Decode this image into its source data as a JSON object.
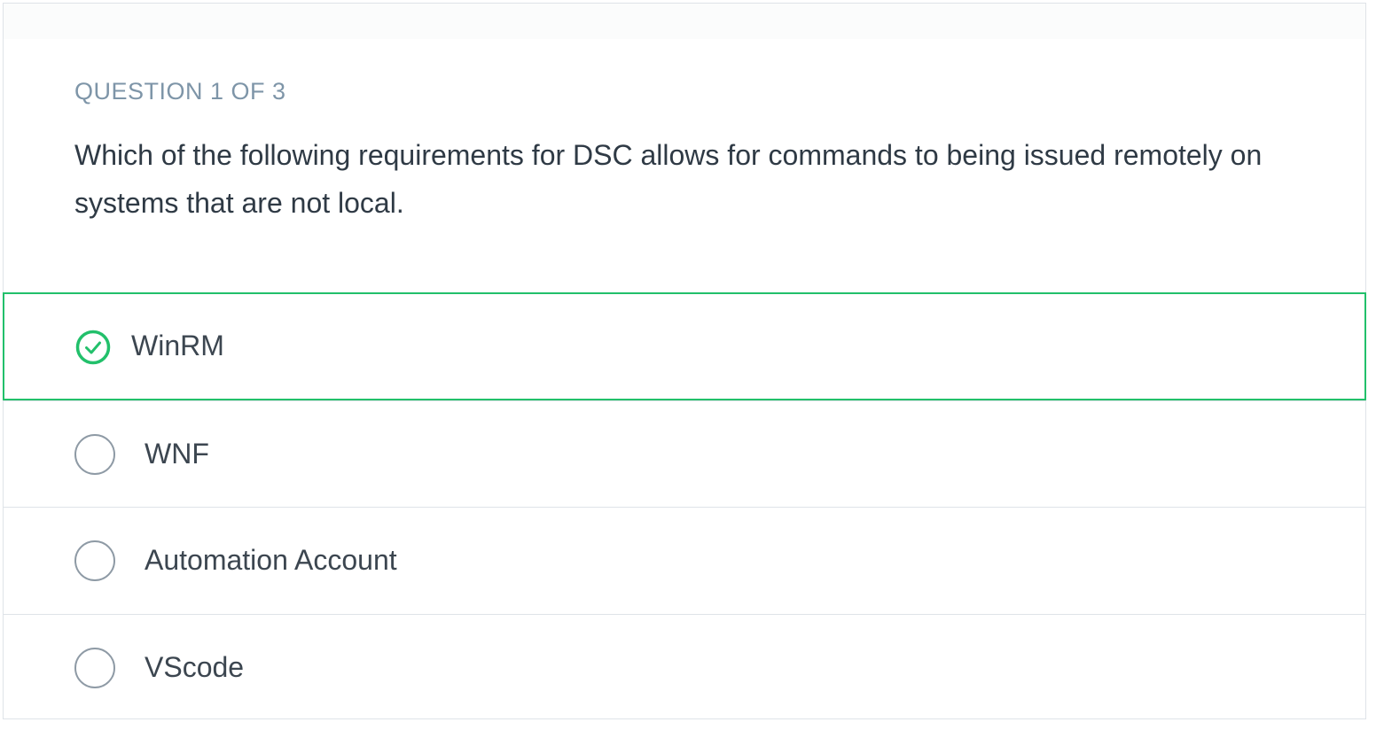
{
  "question": {
    "counter": "QUESTION 1 OF 3",
    "text": "Which of the following requirements for DSC allows for commands to being issued remotely on systems that are not local."
  },
  "options": [
    {
      "label": "WinRM",
      "state": "correct",
      "icon": "check-circle-icon"
    },
    {
      "label": "WNF",
      "state": "unselected",
      "icon": "radio-circle-icon"
    },
    {
      "label": "Automation Account",
      "state": "unselected",
      "icon": "radio-circle-icon"
    },
    {
      "label": "VScode",
      "state": "unselected",
      "icon": "radio-circle-icon"
    }
  ],
  "colors": {
    "correct": "#22c06b",
    "counter": "#7e95a8",
    "text": "#2f3a45",
    "border": "#dfe3e8",
    "radio": "#8e9aa5"
  }
}
